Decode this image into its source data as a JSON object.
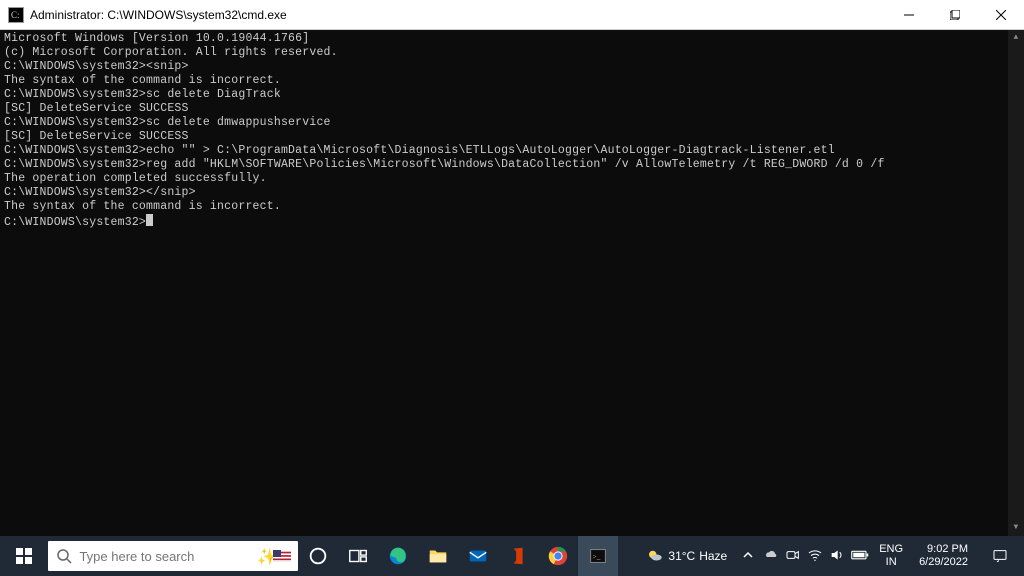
{
  "window": {
    "title": "Administrator: C:\\WINDOWS\\system32\\cmd.exe"
  },
  "terminal": {
    "lines": [
      "Microsoft Windows [Version 10.0.19044.1766]",
      "(c) Microsoft Corporation. All rights reserved.",
      "",
      "C:\\WINDOWS\\system32><snip>",
      "The syntax of the command is incorrect.",
      "",
      "C:\\WINDOWS\\system32>sc delete DiagTrack",
      "[SC] DeleteService SUCCESS",
      "",
      "C:\\WINDOWS\\system32>sc delete dmwappushservice",
      "[SC] DeleteService SUCCESS",
      "",
      "C:\\WINDOWS\\system32>echo \"\" > C:\\ProgramData\\Microsoft\\Diagnosis\\ETLLogs\\AutoLogger\\AutoLogger-Diagtrack-Listener.etl",
      "",
      "C:\\WINDOWS\\system32>reg add \"HKLM\\SOFTWARE\\Policies\\Microsoft\\Windows\\DataCollection\" /v AllowTelemetry /t REG_DWORD /d 0 /f",
      "The operation completed successfully.",
      "",
      "C:\\WINDOWS\\system32></snip>",
      "The syntax of the command is incorrect.",
      "",
      "C:\\WINDOWS\\system32>"
    ]
  },
  "taskbar": {
    "search_placeholder": "Type here to search",
    "weather_temp": "31°C",
    "weather_cond": "Haze",
    "lang_top": "ENG",
    "lang_bot": "IN",
    "time": "9:02 PM",
    "date": "6/29/2022"
  }
}
